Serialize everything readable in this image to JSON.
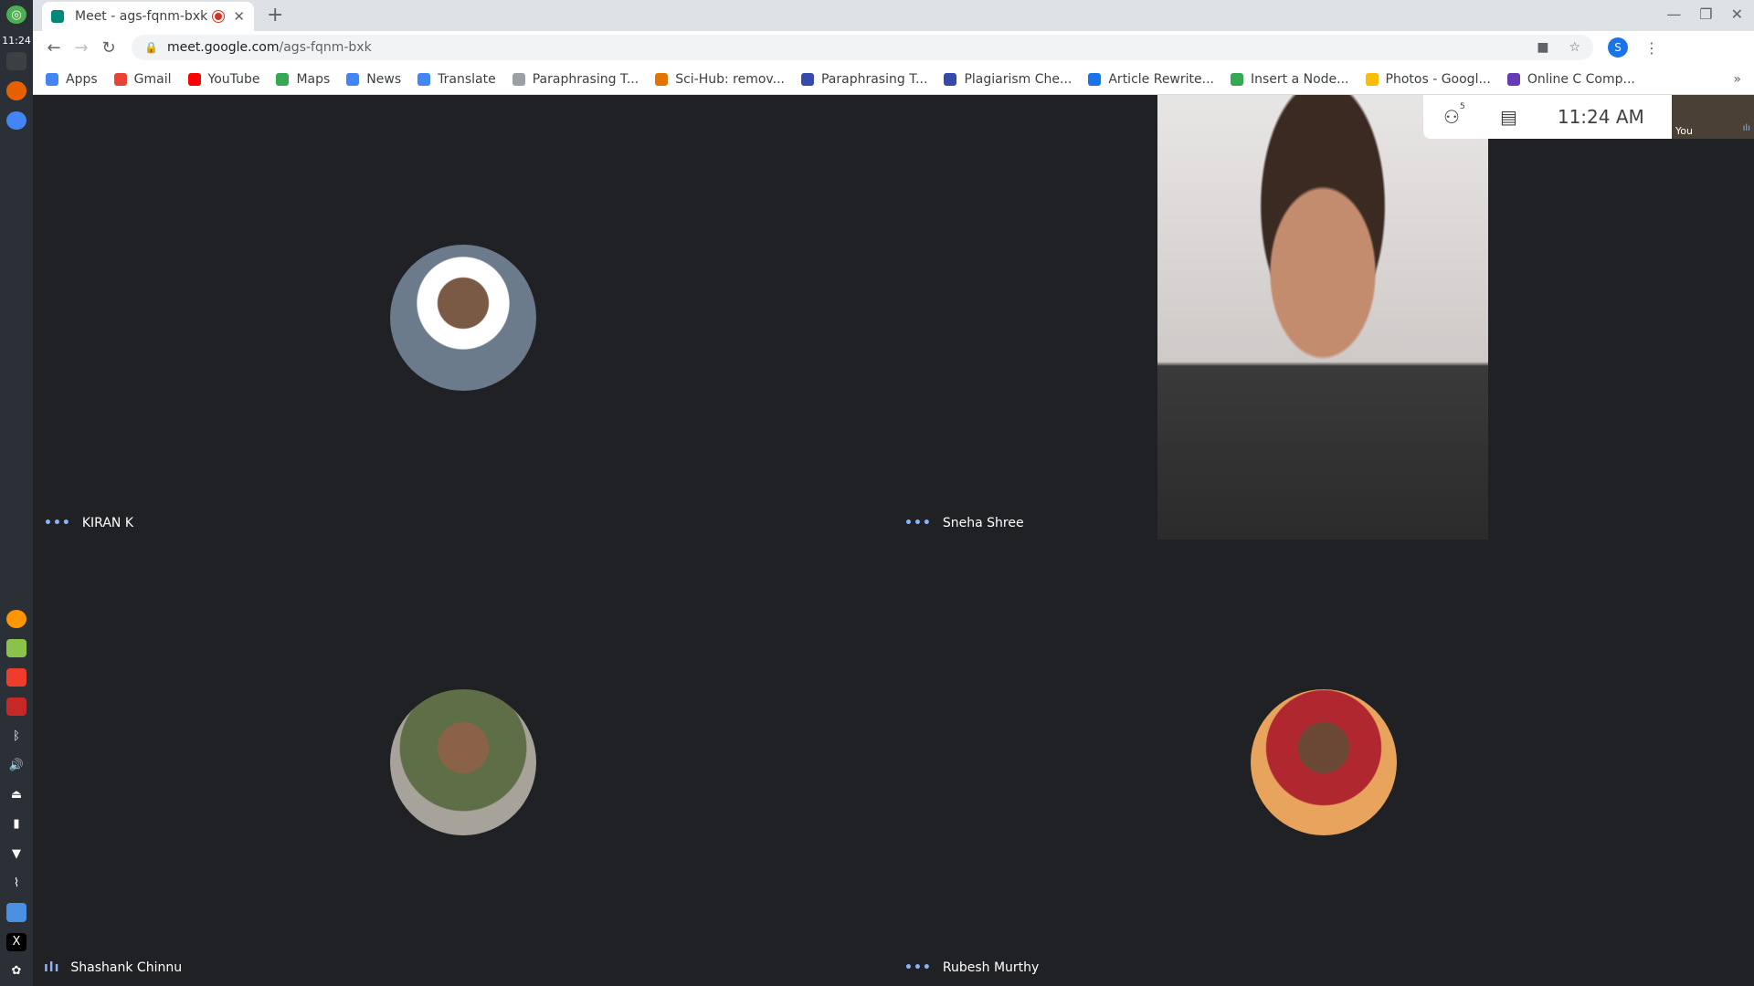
{
  "os": {
    "clock": "11:24"
  },
  "tab": {
    "title": "Meet - ags-fqnm-bxk",
    "close": "✕",
    "new_tab": "+"
  },
  "toolbar": {
    "url_domain": "meet.google.com",
    "url_path": "/ags-fqnm-bxk",
    "profile_initial": "S"
  },
  "bookmarks": [
    {
      "label": "Apps",
      "color": "#4285f4",
      "icon": "apps-grid-icon"
    },
    {
      "label": "Gmail",
      "color": "#ea4335",
      "icon": "gmail-icon"
    },
    {
      "label": "YouTube",
      "color": "#ff0000",
      "icon": "youtube-icon"
    },
    {
      "label": "Maps",
      "color": "#34a853",
      "icon": "maps-icon"
    },
    {
      "label": "News",
      "color": "#4285f4",
      "icon": "news-icon"
    },
    {
      "label": "Translate",
      "color": "#4285f4",
      "icon": "translate-icon"
    },
    {
      "label": "Paraphrasing T...",
      "color": "#9aa0a6",
      "icon": "paraphrasing-icon"
    },
    {
      "label": "Sci-Hub: remov...",
      "color": "#e37400",
      "icon": "scihub-icon"
    },
    {
      "label": "Paraphrasing T...",
      "color": "#3949ab",
      "icon": "paraphrasing-icon"
    },
    {
      "label": "Plagiarism Che...",
      "color": "#3949ab",
      "icon": "plagiarism-icon"
    },
    {
      "label": "Article Rewrite...",
      "color": "#1a73e8",
      "icon": "rewrite-icon"
    },
    {
      "label": "Insert a Node...",
      "color": "#34a853",
      "icon": "insert-node-icon"
    },
    {
      "label": "Photos - Googl...",
      "color": "#fbbc04",
      "icon": "photos-icon"
    },
    {
      "label": "Online C Comp...",
      "color": "#673ab7",
      "icon": "compiler-icon"
    }
  ],
  "meet": {
    "participants_count": "5",
    "time": "11:24 AM",
    "self_label": "You",
    "tiles": [
      {
        "name": "KIRAN K",
        "indicator": "•••"
      },
      {
        "name": "Sneha Shree",
        "indicator": "•••"
      },
      {
        "name": "Shashank Chinnu",
        "indicator": "ılı"
      },
      {
        "name": "Rubesh Murthy",
        "indicator": "•••"
      }
    ]
  }
}
